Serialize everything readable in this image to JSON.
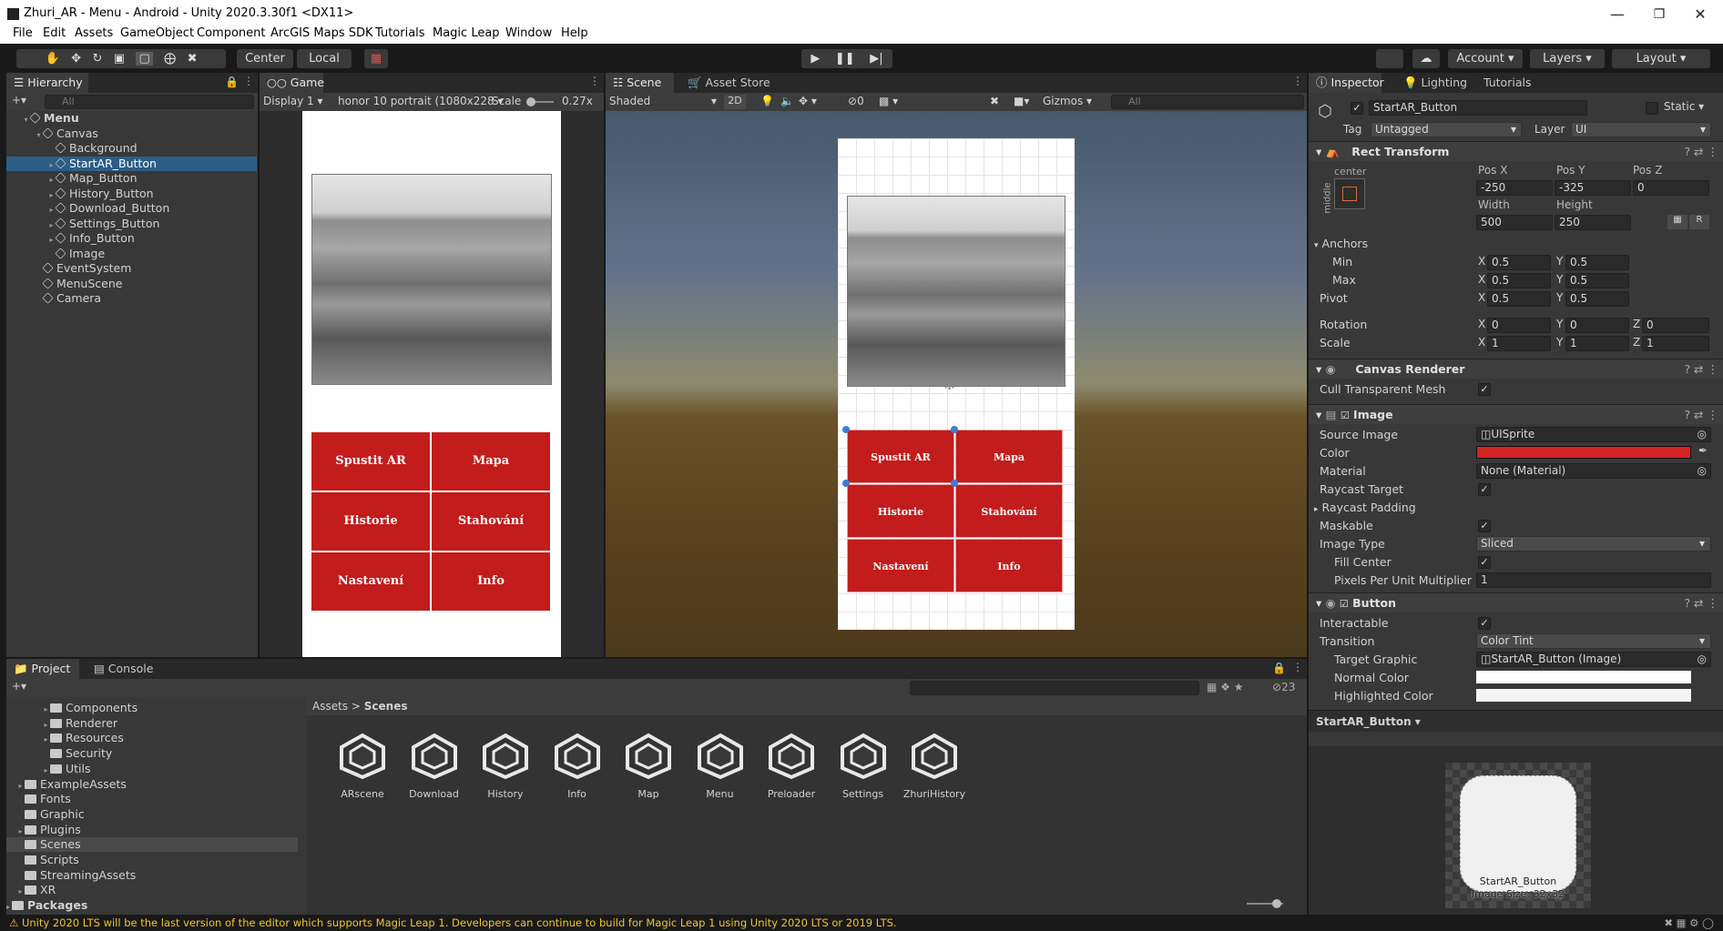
{
  "window": {
    "title": "Zhuri_AR - Menu - Android - Unity 2020.3.30f1 <DX11>"
  },
  "menu": [
    "File",
    "Edit",
    "Assets",
    "GameObject",
    "Component",
    "ArcGIS Maps SDK",
    "Tutorials",
    "Magic Leap",
    "Window",
    "Help"
  ],
  "toolbar": {
    "center": "Center",
    "local": "Local",
    "account": "Account",
    "layers": "Layers",
    "layout": "Layout"
  },
  "hierarchy": {
    "tab": "Hierarchy",
    "search": "All",
    "items": [
      {
        "label": "Menu",
        "depth": 0
      },
      {
        "label": "Canvas",
        "depth": 1
      },
      {
        "label": "Background",
        "depth": 2
      },
      {
        "label": "StartAR_Button",
        "depth": 2
      },
      {
        "label": "Map_Button",
        "depth": 2
      },
      {
        "label": "History_Button",
        "depth": 2
      },
      {
        "label": "Download_Button",
        "depth": 2
      },
      {
        "label": "Settings_Button",
        "depth": 2
      },
      {
        "label": "Info_Button",
        "depth": 2
      },
      {
        "label": "Image",
        "depth": 2
      },
      {
        "label": "EventSystem",
        "depth": 1
      },
      {
        "label": "MenuScene",
        "depth": 1
      },
      {
        "label": "Camera",
        "depth": 1
      }
    ]
  },
  "game": {
    "tab": "Game",
    "display": "Display 1",
    "resolution": "honor 10 portrait (1080x228",
    "scale_label": "Scale",
    "scale_value": "0.27x",
    "buttons": [
      "Spustit AR",
      "Mapa",
      "Historie",
      "Stahování",
      "Nastavení",
      "Info"
    ]
  },
  "scene": {
    "tab": "Scene",
    "asset_store": "Asset Store",
    "shading": "Shaded",
    "mode2d": "2D",
    "hidden": "0",
    "gizmos": "Gizmos",
    "search": "All"
  },
  "inspector": {
    "tabs": [
      "Inspector",
      "Lighting",
      "Tutorials"
    ],
    "object_name": "StartAR_Button",
    "static": "Static",
    "tag_label": "Tag",
    "tag": "Untagged",
    "layer_label": "Layer",
    "layer": "UI",
    "rect": {
      "title": "Rect Transform",
      "anchor_h": "center",
      "anchor_v": "middle",
      "posx_label": "Pos X",
      "posy_label": "Pos Y",
      "posz_label": "Pos Z",
      "posx": "-250",
      "posy": "-325",
      "posz": "0",
      "width_label": "Width",
      "height_label": "Height",
      "width": "500",
      "height": "250",
      "anchors": "Anchors",
      "min": "Min",
      "max": "Max",
      "pivot": "Pivot",
      "rotation": "Rotation",
      "scale": "Scale",
      "min_x": "0.5",
      "min_y": "0.5",
      "max_x": "0.5",
      "max_y": "0.5",
      "piv_x": "0.5",
      "piv_y": "0.5",
      "rot_x": "0",
      "rot_y": "0",
      "rot_z": "0",
      "sc_x": "1",
      "sc_y": "1",
      "sc_z": "1"
    },
    "canvas_renderer": {
      "title": "Canvas Renderer",
      "cull": "Cull Transparent Mesh"
    },
    "image": {
      "title": "Image",
      "source_label": "Source Image",
      "source": "UISprite",
      "color_label": "Color",
      "color": "#d42222",
      "material_label": "Material",
      "material": "None (Material)",
      "raycast": "Raycast Target",
      "padding": "Raycast Padding",
      "maskable": "Maskable",
      "type_label": "Image Type",
      "type": "Sliced",
      "fill": "Fill Center",
      "ppu_label": "Pixels Per Unit Multiplier",
      "ppu": "1"
    },
    "button": {
      "title": "Button",
      "interactable": "Interactable",
      "transition_label": "Transition",
      "transition": "Color Tint",
      "target_label": "Target Graphic",
      "target": "StartAR_Button (Image)",
      "normal": "Normal Color",
      "highlighted": "Highlighted Color"
    },
    "preview": {
      "header": "StartAR_Button",
      "name": "StartAR_Button",
      "size": "Image Size: 32x32"
    }
  },
  "project": {
    "tabs": [
      "Project",
      "Console"
    ],
    "count": "23",
    "breadcrumb": [
      "Assets",
      "Scenes"
    ],
    "tree": [
      {
        "label": "Components",
        "depth": 3,
        "arrow": true
      },
      {
        "label": "Renderer",
        "depth": 3,
        "arrow": true
      },
      {
        "label": "Resources",
        "depth": 3,
        "arrow": true
      },
      {
        "label": "Security",
        "depth": 3,
        "arrow": false
      },
      {
        "label": "Utils",
        "depth": 3,
        "arrow": true
      },
      {
        "label": "ExampleAssets",
        "depth": 1,
        "arrow": true
      },
      {
        "label": "Fonts",
        "depth": 1,
        "arrow": false
      },
      {
        "label": "Graphic",
        "depth": 1,
        "arrow": false
      },
      {
        "label": "Plugins",
        "depth": 1,
        "arrow": true
      },
      {
        "label": "Scenes",
        "depth": 1,
        "arrow": false
      },
      {
        "label": "Scripts",
        "depth": 1,
        "arrow": false
      },
      {
        "label": "StreamingAssets",
        "depth": 1,
        "arrow": false
      },
      {
        "label": "XR",
        "depth": 1,
        "arrow": true
      },
      {
        "label": "Packages",
        "depth": 0,
        "arrow": true
      }
    ],
    "assets": [
      "ARscene",
      "Download",
      "History",
      "Info",
      "Map",
      "Menu",
      "Preloader",
      "Settings",
      "ZhuriHistory"
    ]
  },
  "status": {
    "message": "Unity 2020 LTS will be the last version of the editor which supports Magic Leap 1. Developers can continue to build for Magic Leap 1 using Unity 2020 LTS or 2019 LTS.",
    "color": "#f4c430"
  }
}
